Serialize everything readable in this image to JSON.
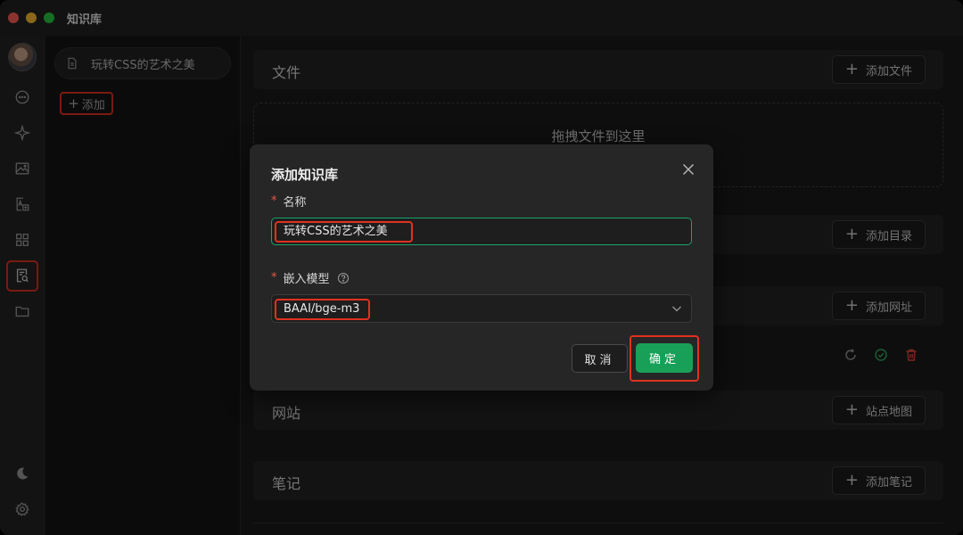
{
  "window": {
    "title": "知识库"
  },
  "knowledge_bases": [
    {
      "label": "玩转CSS的艺术之美"
    }
  ],
  "add_kb": {
    "label": "添加"
  },
  "sections": {
    "files": {
      "title": "文件",
      "button": "添加文件",
      "dropzone": "拖拽文件到这里"
    },
    "directory": {
      "button": "添加目录"
    },
    "url": {
      "button": "添加网址"
    },
    "website": {
      "title": "网站",
      "button": "站点地图"
    },
    "notes": {
      "title": "笔记",
      "button": "添加笔记"
    }
  },
  "modal": {
    "title": "添加知识库",
    "name_label": "名称",
    "name_value": "玩转CSS的艺术之美",
    "model_label": "嵌入模型",
    "model_value": "BAAI/bge-m3",
    "cancel": "取消",
    "ok": "确定",
    "required_mark": "*"
  },
  "colors": {
    "primary": "#18a058",
    "highlight": "#e0311f",
    "focus_border": "#18a46b"
  },
  "icons": [
    "chat-icon",
    "sparkle-icon",
    "image-icon",
    "translate-icon",
    "apps-icon",
    "knowledge-icon",
    "folder-icon",
    "moon-icon",
    "gear-icon"
  ]
}
